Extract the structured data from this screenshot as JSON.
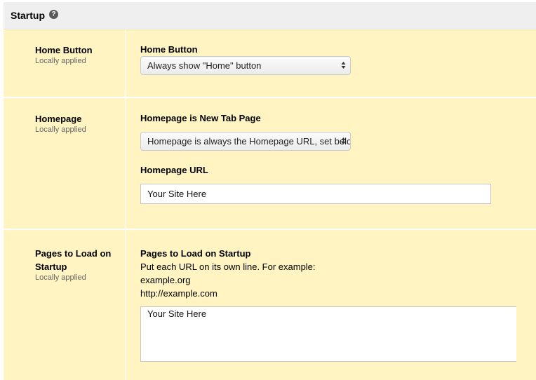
{
  "section": {
    "title": "Startup",
    "help_icon": "question-circle-icon"
  },
  "policies": {
    "home_button": {
      "name": "Home Button",
      "status": "Locally applied",
      "field_label": "Home Button",
      "selected": "Always show \"Home\" button"
    },
    "homepage": {
      "name": "Homepage",
      "status": "Locally applied",
      "field1_label": "Homepage is New Tab Page",
      "field1_selected": "Homepage is always the Homepage URL, set below",
      "field2_label": "Homepage URL",
      "field2_value": "Your Site Here"
    },
    "pages_to_load": {
      "name": "Pages to Load on Startup",
      "status": "Locally applied",
      "field_label": "Pages to Load on Startup",
      "description": "Put each URL on its own line. For example:",
      "example1": "example.org",
      "example2": "http://example.com",
      "value": "Your Site Here"
    }
  },
  "colors": {
    "row_background": "#fff4c2",
    "header_background": "#efefef"
  }
}
